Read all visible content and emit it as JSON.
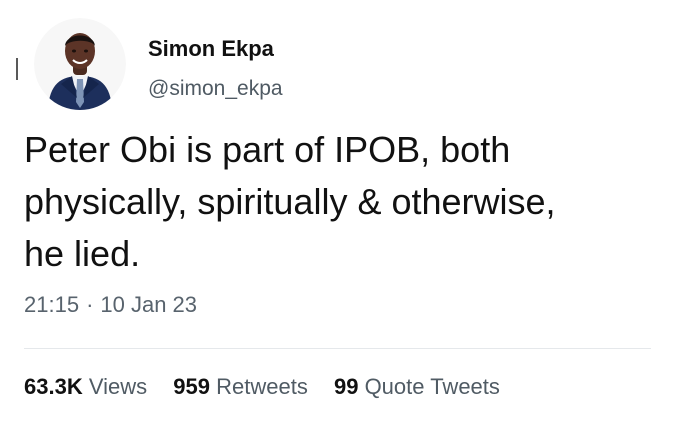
{
  "author": {
    "name": "Simon Ekpa",
    "handle": "@simon_ekpa",
    "avatar_icon": "person-photo-avatar"
  },
  "tweet": {
    "lines": [
      "Peter Obi is part of IPOB, both",
      "physically, spiritually & otherwise,",
      "he lied."
    ],
    "time": "21:15",
    "separator": "·",
    "date": "10 Jan 23"
  },
  "stats": {
    "views_count": "63.3K",
    "views_label": "Views",
    "retweets_count": "959",
    "retweets_label": "Retweets",
    "quotes_count": "99",
    "quotes_label": "Quote Tweets"
  },
  "colors": {
    "text": "#111111",
    "muted": "#58636d",
    "divider": "#e5e8eb"
  }
}
